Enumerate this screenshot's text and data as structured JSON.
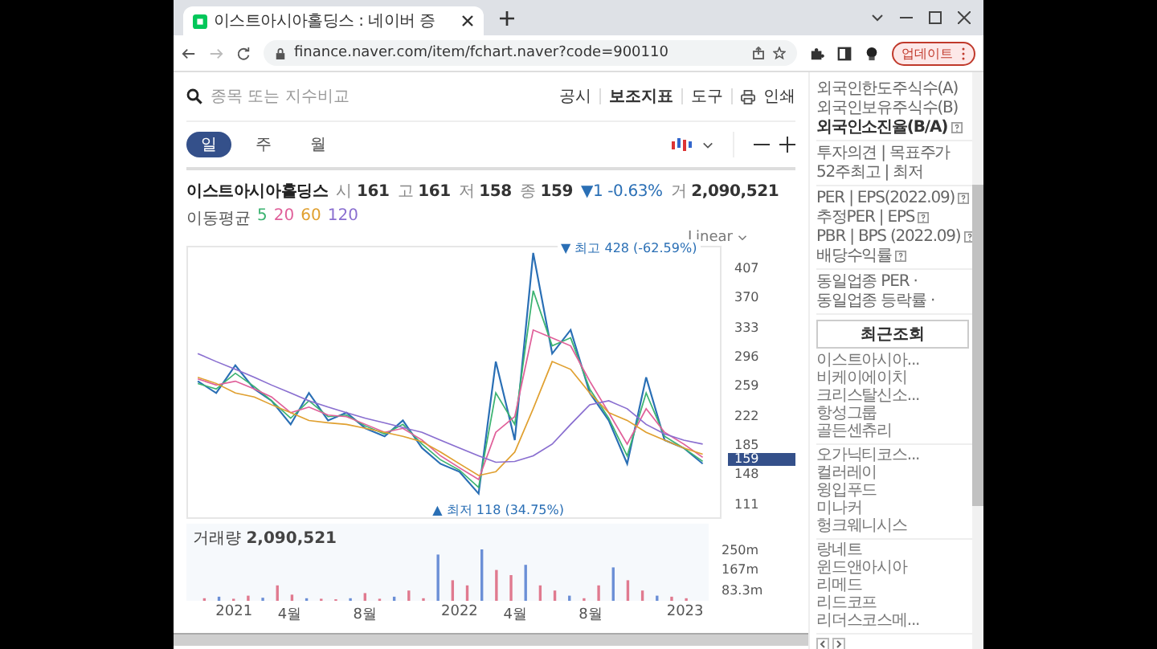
{
  "browser": {
    "tab_title": "이스트아시아홀딩스 : 네이버 증",
    "url": "finance.naver.com/item/fchart.naver?code=900110",
    "update_button": "업데이트"
  },
  "toolbar": {
    "search_placeholder": "종목 또는 지수비교",
    "links": [
      "공시",
      "보조지표",
      "도구",
      "인쇄"
    ]
  },
  "periods": [
    {
      "label": "일",
      "selected": true
    },
    {
      "label": "주",
      "selected": false
    },
    {
      "label": "월",
      "selected": false
    }
  ],
  "quote": {
    "name": "이스트아시아홀딩스",
    "fields": [
      {
        "kind": "field",
        "label": "시",
        "value": "161"
      },
      {
        "kind": "field",
        "label": "고",
        "value": "161"
      },
      {
        "kind": "field",
        "label": "저",
        "value": "158"
      },
      {
        "kind": "field",
        "label": "종",
        "value": "159"
      },
      {
        "kind": "change",
        "value": "▼1 -0.63%"
      },
      {
        "kind": "field",
        "label": "거",
        "value": "2,090,521"
      }
    ]
  },
  "moving_average": {
    "label": "이동평균"
  },
  "scale": "Linear",
  "price_chart": {
    "current": "159",
    "high_label": "▼ 최고 428 (-62.59%)",
    "low_label": "▲ 최저 118 (34.75%)",
    "chart_data": {
      "type": "line",
      "x": [
        "2020-11-01",
        "2020-12-01",
        "2021-01-01",
        "2021-02-01",
        "2021-03-01",
        "2021-04-01",
        "2021-05-01",
        "2021-06-01",
        "2021-07-01",
        "2021-08-01",
        "2021-09-01",
        "2021-10-01",
        "2021-11-01",
        "2021-12-01",
        "2022-01-01",
        "2022-02-01",
        "2022-03-01",
        "2022-04-01",
        "2022-05-01",
        "2022-06-01",
        "2022-07-01",
        "2022-08-01",
        "2022-09-01",
        "2022-10-01",
        "2022-11-01",
        "2022-12-01",
        "2023-01-01",
        "2023-02-01"
      ],
      "series": [
        {
          "color": "#2a6fb5",
          "values": [
            265,
            250,
            285,
            255,
            240,
            210,
            250,
            215,
            225,
            205,
            195,
            215,
            180,
            160,
            150,
            122,
            290,
            190,
            428,
            300,
            330,
            250,
            215,
            160,
            270,
            190,
            180,
            160
          ]
        },
        {
          "name": "5",
          "color": "#3cb371",
          "values": [
            262,
            255,
            275,
            258,
            240,
            218,
            240,
            220,
            222,
            208,
            198,
            210,
            185,
            165,
            152,
            130,
            250,
            210,
            380,
            310,
            320,
            255,
            218,
            170,
            250,
            195,
            180,
            163
          ]
        },
        {
          "name": "20",
          "color": "#e0609a",
          "values": [
            268,
            260,
            265,
            255,
            245,
            225,
            232,
            222,
            220,
            210,
            200,
            205,
            190,
            170,
            155,
            140,
            200,
            220,
            330,
            320,
            310,
            265,
            225,
            185,
            230,
            200,
            185,
            168
          ]
        },
        {
          "name": "60",
          "color": "#e0a030",
          "values": [
            270,
            262,
            250,
            245,
            235,
            225,
            215,
            212,
            210,
            205,
            200,
            195,
            188,
            175,
            160,
            145,
            150,
            175,
            230,
            290,
            280,
            250,
            225,
            215,
            200,
            190,
            180,
            172
          ]
        },
        {
          "name": "120",
          "color": "#8a6fd0",
          "values": [
            300,
            290,
            280,
            270,
            260,
            250,
            240,
            232,
            225,
            218,
            212,
            206,
            200,
            190,
            180,
            170,
            162,
            163,
            170,
            185,
            210,
            235,
            240,
            230,
            210,
            198,
            190,
            185
          ]
        }
      ],
      "xlim": [
        "2020-10-16",
        "2023-03-01"
      ],
      "ylim": [
        92,
        435
      ],
      "yticks": [
        407,
        370,
        333,
        296,
        259,
        222,
        185,
        148,
        111
      ],
      "xticks": [
        {
          "value": "2021-01-01",
          "label": "2021"
        },
        {
          "value": "2021-04-01",
          "label": "4월"
        },
        {
          "value": "2021-08-01",
          "label": "8월"
        },
        {
          "value": "2022-01-01",
          "label": "2022"
        },
        {
          "value": "2022-04-01",
          "label": "4월"
        },
        {
          "value": "2022-08-01",
          "label": "8월"
        },
        {
          "value": "2023-01-01",
          "label": "2023"
        }
      ]
    }
  },
  "volume_chart": {
    "label": "거래량",
    "value": "2,090,521",
    "yticks": [
      "250m",
      "167m",
      "83.3m"
    ]
  },
  "sidebar": {
    "groups": [
      [
        {
          "text": "외국인한도주식수(A)",
          "bold": false,
          "help": false
        },
        {
          "text": "외국인보유주식수(B)",
          "bold": false,
          "help": false
        },
        {
          "text": "외국인소진율(B/A)",
          "bold": true,
          "help": true
        }
      ],
      [
        {
          "text": "투자의견 | 목표주가",
          "bold": false,
          "help": false
        },
        {
          "text": "52주최고 | 최저",
          "bold": false,
          "help": false
        }
      ],
      [
        {
          "text": "PER | EPS(2022.09)",
          "bold": false,
          "help": true
        },
        {
          "text": "추정PER | EPS",
          "bold": false,
          "help": true
        },
        {
          "text": "PBR | BPS (2022.09)",
          "bold": false,
          "help": true
        },
        {
          "text": "배당수익률",
          "bold": false,
          "help": true
        }
      ],
      [
        {
          "text": "동일업종 PER ·",
          "bold": false,
          "help": false
        },
        {
          "text": "동일업종 등락률 ·",
          "bold": false,
          "help": false
        }
      ]
    ],
    "recent_title": "최근조회",
    "recent": [
      [
        "이스트아시아...",
        "비케이에이치",
        "크리스탈신소...",
        "항성그룹",
        "골든센츄리"
      ],
      [
        "오가닉티코스...",
        "컬러레이",
        "윙입푸드",
        "미나커",
        "헝크웨니시스"
      ],
      [
        "랑네트",
        "윈드앤아시아",
        "리메드",
        "리드코프",
        "리더스코스메..."
      ]
    ]
  }
}
